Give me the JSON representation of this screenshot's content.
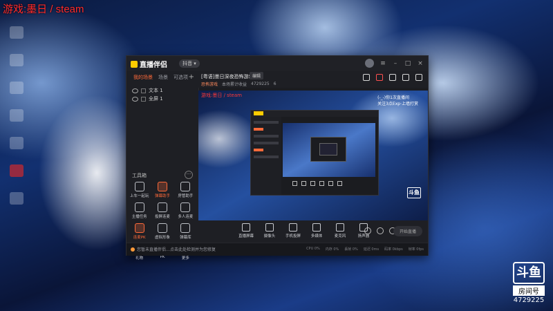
{
  "overlay": {
    "text": "游戏:墨日 / steam",
    "color": "#ff2a2a"
  },
  "desktop_icons": [
    "app-icon",
    "app-icon",
    "app-icon",
    "app-icon",
    "app-icon",
    "youtube-icon",
    "app-icon"
  ],
  "app": {
    "title": "直播伴侣",
    "version_pill": "抖音 ▾"
  },
  "left_tabs": {
    "active": "我的场景",
    "tab2": "场景",
    "tab3": "可选项",
    "add": "+"
  },
  "scenes": [
    {
      "name": "文本 1"
    },
    {
      "name": "全屏 1"
    }
  ],
  "tools": {
    "header": "工具箱",
    "more": "···",
    "items": [
      {
        "label": "上车一起玩"
      },
      {
        "label": "弹幕助手",
        "hot": true
      },
      {
        "label": "房管助手"
      },
      {
        "label": "主播任务"
      },
      {
        "label": "投屏连麦"
      },
      {
        "label": "多人连麦"
      },
      {
        "label": "连麦PK",
        "hot": true
      },
      {
        "label": "虚拟形象"
      },
      {
        "label": "弹幕库"
      },
      {
        "label": "礼物"
      },
      {
        "label": "PK"
      },
      {
        "label": "更多"
      }
    ]
  },
  "room": {
    "title": "[粤语]墨日深夜恐怖游戏",
    "edit": "编辑",
    "category": "恐怖游戏",
    "sub_text": "本场累计收益",
    "room_id": "4729225",
    "likes": "6"
  },
  "preview": {
    "red_text": "游戏:墨日 / steam",
    "side_text": [
      "(-_-)你1次直播间",
      "关注3点Exp·上墙打赏"
    ],
    "mini_logo": "斗鱼"
  },
  "bottombar": {
    "items": [
      "直播屏幕",
      "摄像头",
      "手机投屏",
      "多媒体",
      "麦克风",
      "扬声器"
    ],
    "start_label": "开始直播"
  },
  "status": {
    "message": "您暂未直播伴侣…点击此处检测并为您修复",
    "stats": [
      "CPU 0%",
      "内存 0%",
      "丢帧 0%",
      "延迟 0ms",
      "码率 0kbps",
      "帧率 0fps"
    ]
  },
  "douyu": {
    "logo": "斗鱼",
    "room_label": "房间号",
    "room_num": "4729225"
  }
}
